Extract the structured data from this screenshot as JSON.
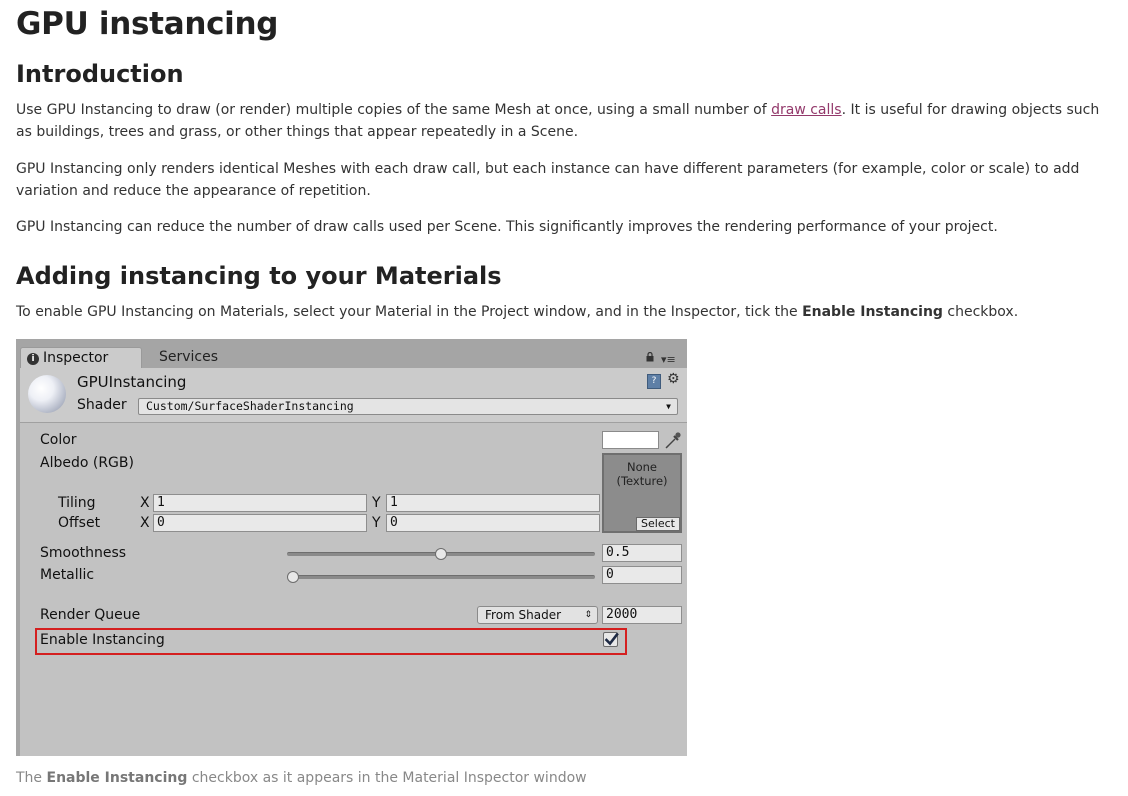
{
  "doc": {
    "title": "GPU instancing",
    "intro_heading": "Introduction",
    "p1_a": "Use GPU Instancing to draw (or render) multiple copies of the same Mesh at once, using a small number of ",
    "p1_link": "draw calls",
    "p1_b": ". It is useful for drawing objects such as buildings, trees and grass, or other things that appear repeatedly in a Scene.",
    "p2": "GPU Instancing only renders identical Meshes with each draw call, but each instance can have different parameters (for example, color or scale) to add variation and reduce the appearance of repetition.",
    "p3": "GPU Instancing can reduce the number of draw calls used per Scene. This significantly improves the rendering performance of your project.",
    "section_heading": "Adding instancing to your Materials",
    "p4_a": "To enable GPU Instancing on Materials, select your Material in the Project window, and in the Inspector, tick the ",
    "p4_bold": "Enable Instancing",
    "p4_b": " checkbox.",
    "caption_a": "The ",
    "caption_bold": "Enable Instancing",
    "caption_b": " checkbox as it appears in the Material Inspector window",
    "link_color": "#93396b"
  },
  "inspector": {
    "tabs": {
      "active": "Inspector",
      "inactive": "Services"
    },
    "icons": [
      "info-icon",
      "lock-icon",
      "menu-icon",
      "material-sphere-icon",
      "book-icon",
      "gear-icon",
      "eyedropper-icon",
      "checkmark-icon"
    ],
    "material_name": "GPUInstancing",
    "shader_label": "Shader",
    "shader_value": "Custom/SurfaceShaderInstancing",
    "color_label": "Color",
    "albedo_label": "Albedo (RGB)",
    "texture_none": "None\n(Texture)",
    "texture_select": "Select",
    "tiling_label": "Tiling",
    "offset_label": "Offset",
    "x_label": "X",
    "y_label": "Y",
    "tiling_x": "1",
    "tiling_y": "1",
    "offset_x": "0",
    "offset_y": "0",
    "smoothness_label": "Smoothness",
    "smoothness_value": "0.5",
    "smoothness_fraction": 0.5,
    "metallic_label": "Metallic",
    "metallic_value": "0",
    "metallic_fraction": 0,
    "render_queue_label": "Render Queue",
    "render_queue_mode": "From Shader",
    "render_queue_value": "2000",
    "enable_instancing_label": "Enable Instancing",
    "enable_instancing_checked": true,
    "highlight_color": "#d41f1f"
  }
}
